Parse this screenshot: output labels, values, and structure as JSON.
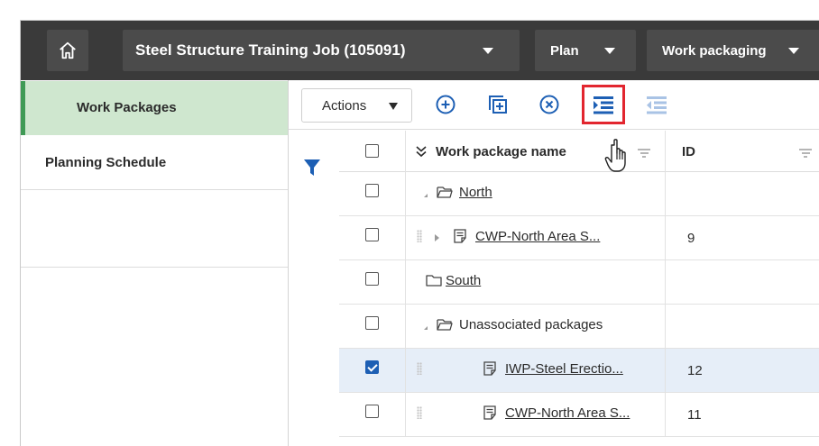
{
  "header": {
    "job_name": "Steel Structure Training Job (105091)",
    "plan_label": "Plan",
    "work_packaging_label": "Work packaging"
  },
  "sidebar": {
    "items": [
      {
        "label": "Work Packages",
        "active": true
      },
      {
        "label": "Planning Schedule",
        "active": false
      }
    ]
  },
  "toolbar": {
    "actions_label": "Actions",
    "icons": [
      "add-circle-icon",
      "add-copy-icon",
      "remove-circle-icon",
      "indent-icon",
      "outdent-icon"
    ],
    "highlighted": "indent-icon"
  },
  "grid": {
    "columns": {
      "name": "Work package name",
      "id": "ID"
    },
    "rows": [
      {
        "name": "North",
        "id": "",
        "kind": "folder",
        "checked": false
      },
      {
        "name": "CWP-North Area S...",
        "id": "9",
        "kind": "package",
        "checked": false
      },
      {
        "name": "South",
        "id": "",
        "kind": "folder",
        "checked": false
      },
      {
        "name": "Unassociated packages",
        "id": "",
        "kind": "folder",
        "checked": false
      },
      {
        "name": "IWP-Steel Erectio...",
        "id": "12",
        "kind": "package",
        "checked": true
      },
      {
        "name": "CWP-North Area S...",
        "id": "11",
        "kind": "package",
        "checked": false
      }
    ]
  },
  "colors": {
    "topbar": "#3a3a3a",
    "active_nav": "#cfe7cf",
    "accent_blue": "#1d5fb4",
    "highlight_red": "#e2262f"
  }
}
